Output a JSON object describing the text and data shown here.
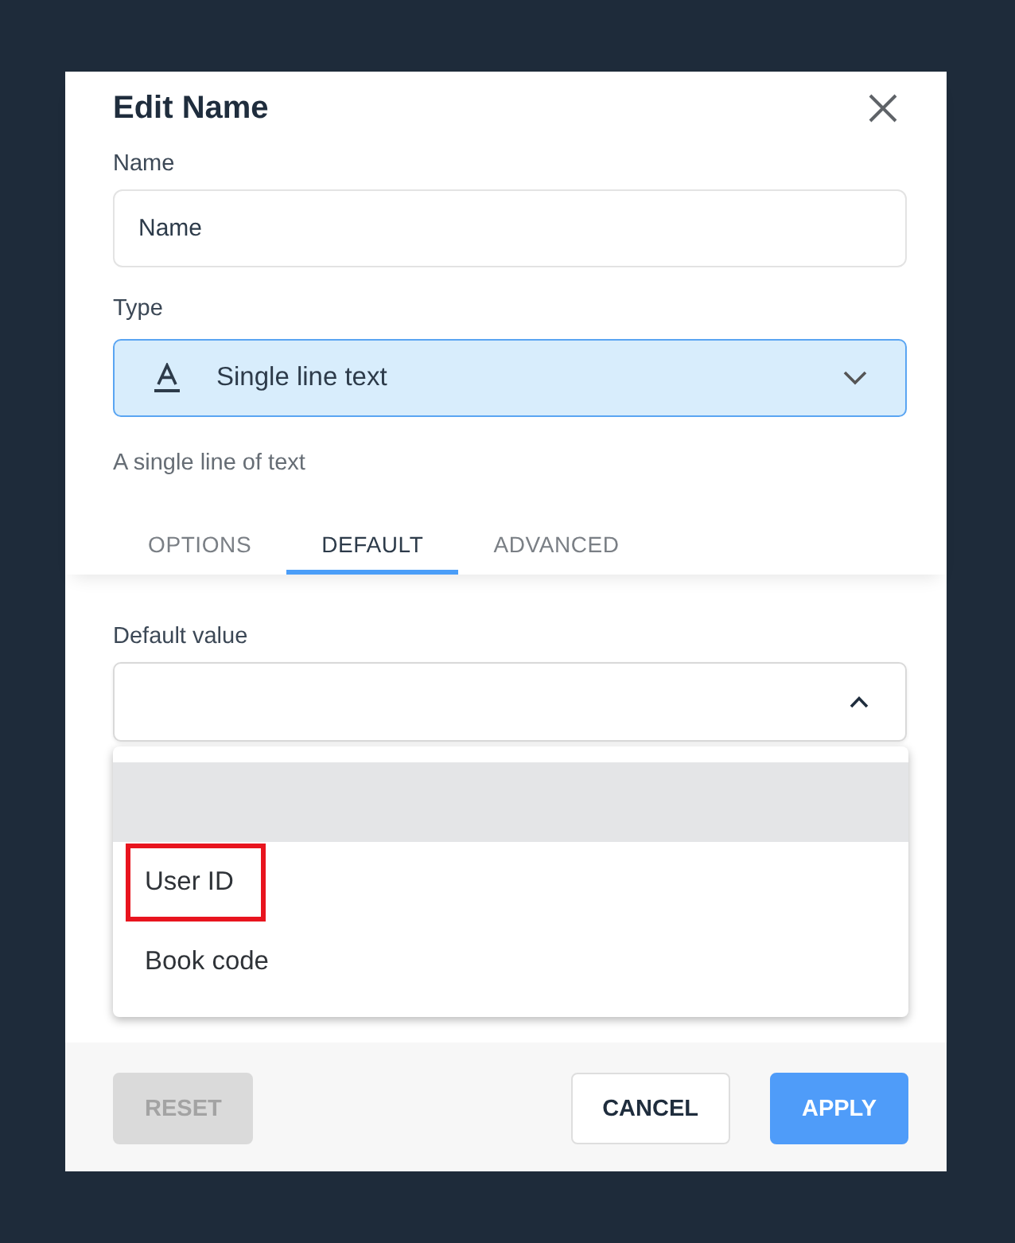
{
  "dialog": {
    "title": "Edit Name"
  },
  "name_field": {
    "label": "Name",
    "value": "Name"
  },
  "type_field": {
    "label": "Type",
    "value": "Single line text",
    "hint": "A single line of text"
  },
  "tabs": [
    {
      "label": "OPTIONS",
      "selected": false
    },
    {
      "label": "DEFAULT",
      "selected": true
    },
    {
      "label": "ADVANCED",
      "selected": false
    }
  ],
  "default_value": {
    "label": "Default value",
    "expanded": true,
    "options": [
      {
        "highlighted": true,
        "outlined": false
      },
      {
        "label": "User ID",
        "highlighted": false,
        "outlined": true
      },
      {
        "label": "Book code",
        "highlighted": false,
        "outlined": false
      }
    ]
  },
  "buttons": [
    {
      "label": "RESET",
      "kind": "secondary",
      "disabled": true
    },
    {
      "label": "CANCEL",
      "kind": "secondary",
      "disabled": false
    },
    {
      "label": "APPLY",
      "kind": "primary",
      "disabled": false
    }
  ]
}
